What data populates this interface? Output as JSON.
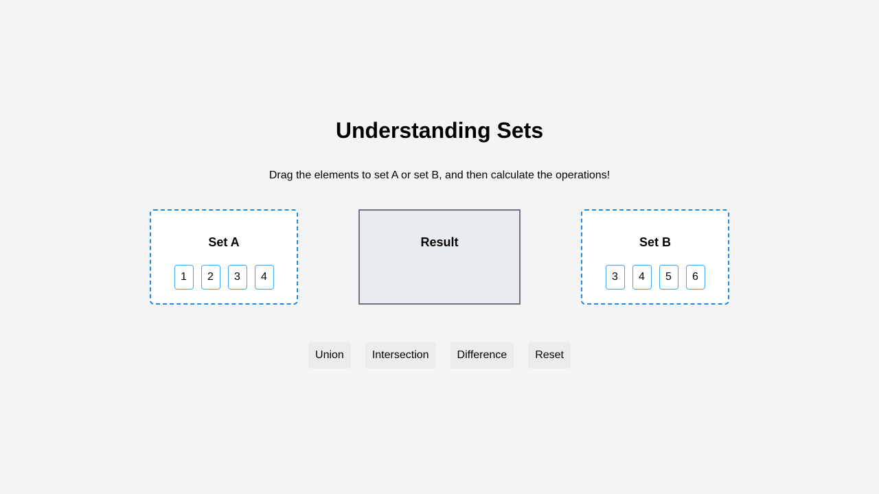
{
  "page": {
    "title": "Understanding Sets",
    "instructions": "Drag the elements to set A or set B, and then calculate the operations!"
  },
  "set_a": {
    "title": "Set A",
    "elements": [
      "1",
      "2",
      "3",
      "4"
    ]
  },
  "result": {
    "title": "Result",
    "content": ""
  },
  "set_b": {
    "title": "Set B",
    "elements": [
      "3",
      "4",
      "5",
      "6"
    ]
  },
  "actions": {
    "union_label": "Union",
    "intersection_label": "Intersection",
    "difference_label": "Difference",
    "reset_label": "Reset"
  },
  "colors": {
    "background": "#f4f4f4",
    "set_border": "#1e88e5",
    "chip_border": "#42a5f5",
    "result_background": "#e8ecef",
    "result_border": "#6c757d",
    "button_background": "#ececec"
  }
}
